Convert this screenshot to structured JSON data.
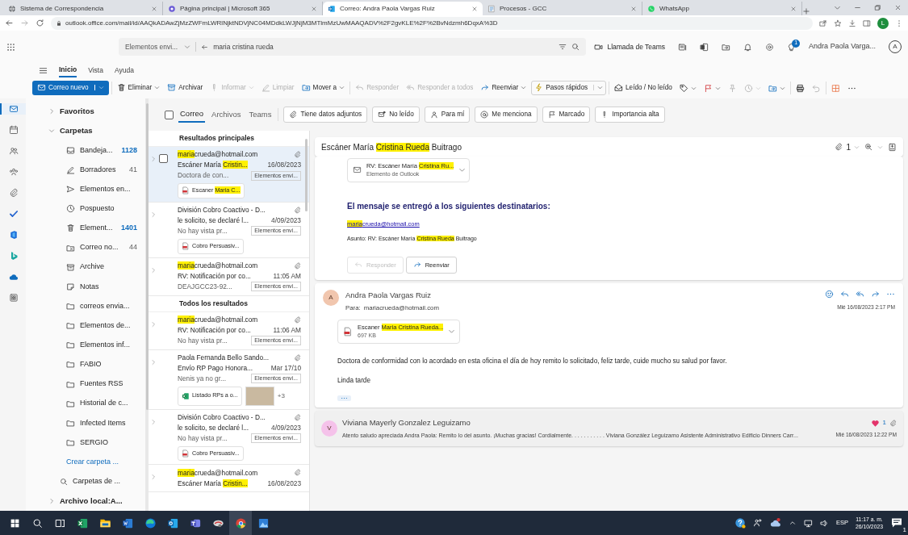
{
  "browser": {
    "tabs": [
      {
        "title": "Sistema de Correspondencia",
        "selected": false
      },
      {
        "title": "Página principal | Microsoft 365",
        "selected": false
      },
      {
        "title": "Correo: Andra Paola Vargas Ruiz",
        "selected": true
      },
      {
        "title": "Procesos - GCC",
        "selected": false
      },
      {
        "title": "WhatsApp",
        "selected": false
      }
    ],
    "url": "outlook.office.com/mail/id/AAQkADAwZjMzZWFmLWRlNjktNDVjNC04MDdkLWJjNjM3MTlmMzUwMAAQADV%2F2gvKLE%2F%2BvNdzmh6DqxA%3D",
    "profile": "L"
  },
  "header": {
    "search_scope": "Elementos envi...",
    "search_query": "maria cristina rueda",
    "teams_call": "Llamada de Teams",
    "notification_badge": "1",
    "user_name": "Andra Paola Varga...",
    "user_initial": "A"
  },
  "rail": [
    {
      "kind": "mail",
      "selected": true
    },
    {
      "kind": "calendar",
      "selected": false
    },
    {
      "kind": "people",
      "selected": false
    },
    {
      "kind": "groups",
      "selected": false
    },
    {
      "kind": "files",
      "selected": false
    },
    {
      "kind": "todo",
      "selected": false
    },
    {
      "kind": "office",
      "selected": false
    },
    {
      "kind": "bing",
      "selected": false
    },
    {
      "kind": "onedrive",
      "selected": false
    },
    {
      "kind": "apps",
      "selected": false
    }
  ],
  "ribbon": {
    "tabs": [
      {
        "label": "Inicio",
        "selected": true
      },
      {
        "label": "Vista",
        "selected": false
      },
      {
        "label": "Ayuda",
        "selected": false
      }
    ],
    "commands": [
      {
        "kind": "primary",
        "label": "Correo nuevo",
        "dropdown": true,
        "disabled": false
      },
      {
        "kind": "button",
        "label": "Eliminar",
        "dropdown": true,
        "disabled": false
      },
      {
        "kind": "button",
        "label": "Archivar",
        "dropdown": false,
        "disabled": false
      },
      {
        "kind": "button",
        "label": "Informar",
        "dropdown": true,
        "disabled": true
      },
      {
        "kind": "button",
        "label": "Limpiar",
        "dropdown": false,
        "disabled": true
      },
      {
        "kind": "button",
        "label": "Mover a",
        "dropdown": true,
        "disabled": false
      },
      {
        "kind": "button",
        "label": "Responder",
        "dropdown": false,
        "disabled": true
      },
      {
        "kind": "button",
        "label": "Responder a todos",
        "dropdown": false,
        "disabled": true
      },
      {
        "kind": "button",
        "label": "Reenviar",
        "dropdown": true,
        "disabled": false
      },
      {
        "kind": "split",
        "label": "Pasos rápidos",
        "dropdown": true,
        "disabled": false
      },
      {
        "kind": "button",
        "label": "Leído / No leído",
        "dropdown": false,
        "disabled": false
      },
      {
        "kind": "icon",
        "dropdown": true,
        "disabled": false
      },
      {
        "kind": "icon",
        "dropdown": true,
        "disabled": false
      },
      {
        "kind": "icon",
        "dropdown": false,
        "disabled": true
      },
      {
        "kind": "icon",
        "dropdown": true,
        "disabled": true
      },
      {
        "kind": "icon",
        "dropdown": true,
        "disabled": false
      },
      {
        "kind": "icon",
        "dropdown": false,
        "disabled": false
      },
      {
        "kind": "icon",
        "dropdown": false,
        "disabled": true
      },
      {
        "kind": "icon",
        "dropdown": false,
        "disabled": false
      },
      {
        "kind": "icon",
        "dropdown": false,
        "disabled": false
      }
    ]
  },
  "folders": {
    "favorites": {
      "label": "Favoritos",
      "expanded": false
    },
    "group": {
      "label": "Carpetas",
      "expanded": true
    },
    "items": [
      {
        "kind": "inbox",
        "label": "Bandeja...",
        "count": "1128",
        "unread": true
      },
      {
        "kind": "drafts",
        "label": "Borradores",
        "count": "41",
        "unread": false
      },
      {
        "kind": "sent",
        "label": "Elementos en..."
      },
      {
        "kind": "snoozed",
        "label": "Pospuesto"
      },
      {
        "kind": "deleted",
        "label": "Element...",
        "count": "1401",
        "unread": true
      },
      {
        "kind": "junk",
        "label": "Correo no...",
        "count": "44",
        "unread": false
      },
      {
        "kind": "archive",
        "label": "Archive"
      },
      {
        "kind": "notes",
        "label": "Notas"
      },
      {
        "kind": "folder",
        "label": "correos envia..."
      },
      {
        "kind": "folder",
        "label": "Elementos de..."
      },
      {
        "kind": "folder",
        "label": "Elementos inf..."
      },
      {
        "kind": "folder",
        "label": "FABIO"
      },
      {
        "kind": "folder",
        "label": "Fuentes RSS"
      },
      {
        "kind": "folder",
        "label": "Historial de c..."
      },
      {
        "kind": "folder",
        "label": "Infected Items"
      },
      {
        "kind": "folder",
        "label": "SERGIO"
      }
    ],
    "create_link": "Crear carpeta ...",
    "search_folders": "Carpetas de ...",
    "local_archive": {
      "label": "Archivo local:A...",
      "expanded": false
    }
  },
  "filters": {
    "select_all": false,
    "scopes": [
      {
        "label": "Correo",
        "selected": true
      },
      {
        "label": "Archivos",
        "selected": false
      },
      {
        "label": "Teams",
        "selected": false
      }
    ],
    "chips": [
      {
        "kind": "attachments",
        "label": "Tiene datos adjuntos"
      },
      {
        "kind": "unread",
        "label": "No leído"
      },
      {
        "kind": "to_me",
        "label": "Para mí"
      },
      {
        "kind": "mentions",
        "label": "Me menciona"
      },
      {
        "kind": "flagged",
        "label": "Marcado"
      },
      {
        "kind": "important",
        "label": "Importancia alta"
      }
    ]
  },
  "results": [
    {
      "title": "Resultados principales",
      "messages": [
        {
          "selected": true,
          "has_attachment": true,
          "sender": [
            {
              "text": "maria",
              "highlight": true
            },
            {
              "text": "crueda@hotmail.com",
              "highlight": false
            }
          ],
          "subject": [
            {
              "text": "Escáner María ",
              "highlight": false
            },
            {
              "text": "Cristin...",
              "highlight": true
            }
          ],
          "date": "16/08/2023",
          "preview": "Doctora de con...",
          "folder": "Elementos envi...",
          "attachments": [
            {
              "kind": "pdf",
              "name": [
                {
                  "text": "Escaner ",
                  "highlight": false
                },
                {
                  "text": "Maria C...",
                  "highlight": true
                }
              ]
            }
          ]
        },
        {
          "selected": false,
          "has_attachment": true,
          "sender": "División Cobro Coactivo - D...",
          "subject": "le solicito, se declaré l...",
          "date": "4/09/2023",
          "preview": "No hay vista pr...",
          "folder": "Elementos envi...",
          "attachments": [
            {
              "kind": "pdf",
              "name": "Cobro Persuasiv..."
            }
          ]
        },
        {
          "selected": false,
          "has_attachment": true,
          "sender": [
            {
              "text": "maria",
              "highlight": true
            },
            {
              "text": "crueda@hotmail.com",
              "highlight": false
            }
          ],
          "subject": "RV: Notificación por co...",
          "date": "11:05 AM",
          "preview": "DEAJGCC23-92...",
          "folder": "Elementos envi..."
        }
      ]
    },
    {
      "title": "Todos los resultados",
      "messages": [
        {
          "selected": false,
          "has_attachment": true,
          "sender": [
            {
              "text": "maria",
              "highlight": true
            },
            {
              "text": "crueda@hotmail.com",
              "highlight": false
            }
          ],
          "subject": "RV: Notificación por co...",
          "date": "11:06 AM",
          "preview": "No hay vista pr...",
          "folder": "Elementos envi..."
        },
        {
          "selected": false,
          "has_attachment": true,
          "sender": "Paola Fernanda Bello Sando...",
          "subject": "Envío RP Pago Honora...",
          "date": "Mar 17/10",
          "preview": "Nenis ya no gr...",
          "folder": "Elementos envi...",
          "attachments": [
            {
              "kind": "excel",
              "name": "Listado RPs a o..."
            },
            {
              "kind": "image"
            }
          ],
          "more_attachments": "+3"
        },
        {
          "selected": false,
          "has_attachment": true,
          "sender": "División Cobro Coactivo - D...",
          "subject": "le solicito, se declaré l...",
          "date": "4/09/2023",
          "preview": "No hay vista pr...",
          "folder": "Elementos envi...",
          "attachments": [
            {
              "kind": "pdf",
              "name": "Cobro Persuasiv..."
            }
          ]
        },
        {
          "selected": false,
          "has_attachment": true,
          "sender": [
            {
              "text": "maria",
              "highlight": true
            },
            {
              "text": "crueda@hotmail.com",
              "highlight": false
            }
          ],
          "subject": [
            {
              "text": "Escáner María ",
              "highlight": false
            },
            {
              "text": "Cristin...",
              "highlight": true
            }
          ],
          "date": "16/08/2023"
        }
      ]
    }
  ],
  "reading": {
    "subject": [
      {
        "text": "Escáner María ",
        "highlight": false
      },
      {
        "text": "Cristina Rueda",
        "highlight": true
      },
      {
        "text": " Buitrago",
        "highlight": false
      }
    ],
    "attachment_count": "1",
    "forwarded_item": {
      "name": [
        {
          "text": "RV: Escáner María ",
          "highlight": false
        },
        {
          "text": "Cristina Ru...",
          "highlight": true
        }
      ],
      "type": "Elemento de Outlook"
    },
    "delivery_heading": "El mensaje se entregó a los siguientes destinatarios:",
    "recipient": [
      {
        "text": "maria",
        "highlight": true
      },
      {
        "text": "crueda@hotmail.com",
        "highlight": false
      }
    ],
    "subject_line": [
      {
        "text": "Asunto: RV: Escáner María ",
        "highlight": false
      },
      {
        "text": "Cristina Rueda",
        "highlight": true
      },
      {
        "text": " Buitrago",
        "highlight": false
      }
    ],
    "actions": [
      {
        "label": "Responder",
        "disabled": true
      },
      {
        "label": "Reenviar",
        "disabled": false
      }
    ],
    "messages": [
      {
        "expanded": true,
        "initial": "A",
        "color": "#f1c6ae",
        "sender": "Andra Paola Vargas Ruiz",
        "to_label": "Para:",
        "to": "mariacrueda@hotmail.com",
        "date": "Mié 16/08/2023 2:17 PM",
        "attachment": {
          "name": [
            {
              "text": "Escaner ",
              "highlight": false
            },
            {
              "text": "Maria Cristina Rueda...",
              "highlight": true
            }
          ],
          "size": "697 KB"
        },
        "body": [
          "Doctora de conformidad con lo acordado en esta oficina el día de hoy remito lo solicitado, feliz tarde, cuide mucho su salud por favor.",
          "Linda tarde"
        ]
      },
      {
        "expanded": false,
        "initial": "V",
        "color": "#f5c2ea",
        "sender": "Viviana Mayerly Gonzalez Leguizamo",
        "preview": "Atento saludo apreciada Andra Paola: Remito lo del asunto. ¡Muchas gracias! Cordialmente. . . . . . . . . . . Viviana González Leguizamo Asistente Administrativo Edificio Dinners Carr...",
        "reactions": "1",
        "date": "Mié 16/08/2023 12:22 PM"
      }
    ]
  },
  "taskbar": {
    "apps": [
      {
        "kind": "excel",
        "active": false
      },
      {
        "kind": "explorer",
        "active": false
      },
      {
        "kind": "word",
        "active": false
      },
      {
        "kind": "edge",
        "active": false
      },
      {
        "kind": "outlook",
        "active": false
      },
      {
        "kind": "teams",
        "active": false
      },
      {
        "kind": "tool",
        "active": false
      },
      {
        "kind": "chrome",
        "active": true
      },
      {
        "kind": "photos",
        "active": false
      }
    ],
    "tray": {
      "language": "ESP",
      "time": "11:17 a. m.",
      "date": "26/10/2023",
      "notifications": "1"
    }
  }
}
